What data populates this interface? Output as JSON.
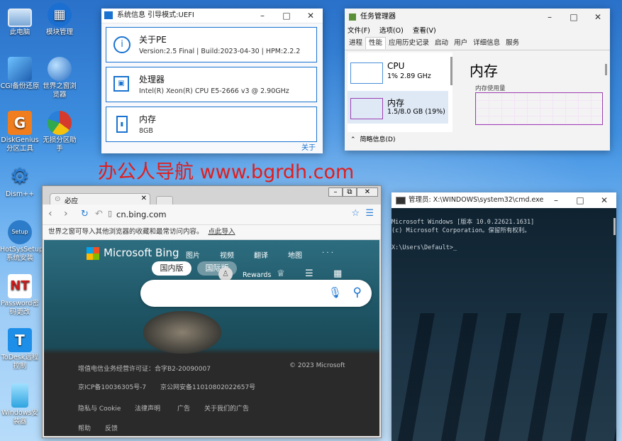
{
  "desktop": {
    "icons": [
      {
        "label": "此电脑",
        "color": "#7aa7d6"
      },
      {
        "label": "模块管理",
        "color": "#1b6fd1"
      },
      {
        "label": "CGI备份还原",
        "color": "#2f8fe8"
      },
      {
        "label": "世界之窗浏览器",
        "color": "#3c86d8"
      },
      {
        "label": "DiskGenius分区工具",
        "color": "#f07d1e"
      },
      {
        "label": "无损分区助手",
        "color": "#d63a2c"
      },
      {
        "label": "Dism++",
        "color": "#2a7fd8"
      },
      {
        "label": "HotSysSetup系统安装",
        "color": "#2d7cc9"
      },
      {
        "label": "Password密码更改",
        "color": "#c81d1d"
      },
      {
        "label": "ToDesk远程控制",
        "color": "#1e8fe8"
      },
      {
        "label": "Windows安装器",
        "color": "#2fa4e0"
      }
    ],
    "watermark": "办公人导航 www.bgrdh.com"
  },
  "sysinfo": {
    "title": "系统信息  引导模式:UEFI",
    "cards": [
      {
        "title": "关于PE",
        "detail": "Version:2.5 Final | Build:2023-04-30 | HPM:2.2.2"
      },
      {
        "title": "处理器",
        "detail": "Intel(R) Xeon(R) CPU E5-2666 v3 @ 2.90GHz"
      },
      {
        "title": "内存",
        "detail": "8GB"
      }
    ],
    "about_link": "关于"
  },
  "taskmgr": {
    "title": "任务管理器",
    "menu": [
      "文件(F)",
      "选项(O)",
      "查看(V)"
    ],
    "tabs": [
      "进程",
      "性能",
      "应用历史记录",
      "启动",
      "用户",
      "详细信息",
      "服务"
    ],
    "cpu": {
      "label": "CPU",
      "detail": "1% 2.89 GHz"
    },
    "mem": {
      "label": "内存",
      "detail": "1.5/8.0 GB (19%)"
    },
    "big_title": "内存",
    "usage_label": "内存使用量",
    "brief": "简略信息(D)"
  },
  "cmd": {
    "title": "管理员: X:\\WINDOWS\\system32\\cmd.exe",
    "line1": "Microsoft Windows [版本 10.0.22621.1631]",
    "line2": "(c) Microsoft Corporation。保留所有权利。",
    "prompt": "X:\\Users\\Default>"
  },
  "browser": {
    "tab_title": "必应",
    "url": "cn.bing.com",
    "import_text": "世界之窗可导入其他浏览器的收藏和最常访问内容。",
    "import_link": "点此导入",
    "bing_logo": "Microsoft Bing",
    "nav": [
      "图片",
      "视频",
      "翻译",
      "地图",
      "· · ·"
    ],
    "tab_cn": "国内版",
    "tab_intl": "国际版",
    "rewards": "Rewards",
    "footer": [
      "增值电信业务经营许可证：合字B2-20090007",
      "© 2023 Microsoft",
      "京ICP备10036305号-7",
      "京公网安备11010802022657号",
      "隐私与 Cookie",
      "法律声明",
      "广告",
      "关于我们的广告",
      "帮助",
      "反馈"
    ]
  }
}
